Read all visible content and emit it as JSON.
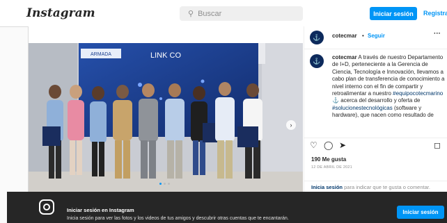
{
  "nav": {
    "logo": "Instagram",
    "search_placeholder": "Buscar",
    "login_label": "Iniciar sesión",
    "register_label": "Registra"
  },
  "post": {
    "username": "cotecmar",
    "separator": "•",
    "follow_label": "Seguir",
    "more": "···",
    "image_banner_left": "ARMADA",
    "image_banner_right": "LINK CO",
    "caption": {
      "username": "cotecmar",
      "text_1": "A través de nuestro Departamento de I+D, perteneciente a la Gerencia de Ciencia, Tecnología e Innovación, llevamos a cabo plan de transferencia de conocimiento a nivel interno con el fin de compartir y retroalimentar a nuestro",
      "tag_1": "#equipocotecmarino",
      "text_2": "acerca del desarrollo y oferta de",
      "tag_2": "#solucionestecnológicas",
      "text_3": "(software y hardware), que nacen como resultado de"
    },
    "likes": "190 Me gusta",
    "date": "12 DE ABRIL DE 2021",
    "cta_link": "Inicia sesión",
    "cta_text": "para indicar que te gusta o comentar."
  },
  "bottom_bar": {
    "title": "Iniciar sesión en Instagram",
    "subtitle": "Inicia sesión para ver las fotos y los videos de tus amigos y descubrir otras cuentas que te encantarán.",
    "button_label": "Iniciar sesión"
  },
  "icons": [
    "search-icon",
    "more-icon",
    "heart-icon",
    "comment-icon",
    "share-icon",
    "bookmark-icon",
    "next-arrow-icon",
    "instagram-icon"
  ],
  "colors": {
    "accent": "#0095f6",
    "bar": "#262626",
    "hashtag": "#00376b"
  }
}
